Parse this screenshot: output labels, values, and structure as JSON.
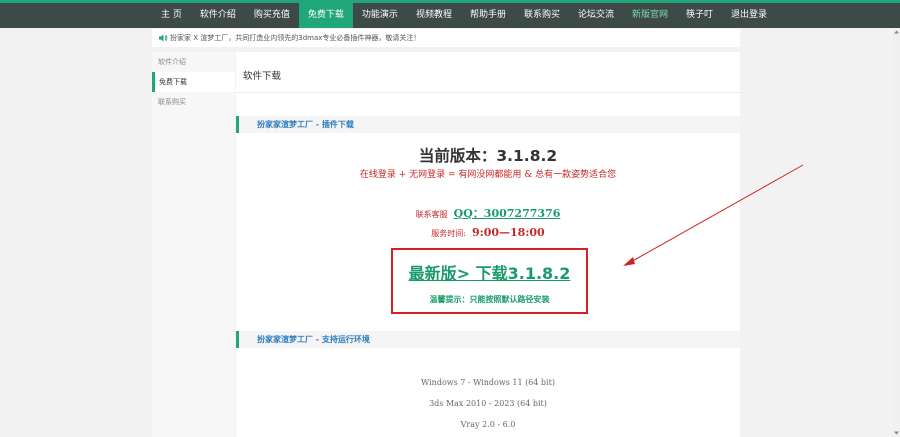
{
  "nav": {
    "items": [
      {
        "label": "主 页"
      },
      {
        "label": "软件介绍"
      },
      {
        "label": "购买充值"
      },
      {
        "label": "免费下载"
      },
      {
        "label": "功能演示"
      },
      {
        "label": "视频教程"
      },
      {
        "label": "帮助手册"
      },
      {
        "label": "联系购买"
      },
      {
        "label": "论坛交流"
      },
      {
        "label": "新版官网"
      },
      {
        "label": "筷子叮"
      },
      {
        "label": "退出登录"
      }
    ],
    "active_index": 3,
    "highlight_index": 9
  },
  "notice": {
    "icon": "speaker-icon",
    "text": "扮家家 X 渲梦工厂，共同打造业内领先的3dmax专业必备插件神器，敬请关注！"
  },
  "sidebar": {
    "items": [
      {
        "label": "软件介绍"
      },
      {
        "label": "免费下载"
      },
      {
        "label": "联系购买"
      }
    ],
    "active_index": 1
  },
  "main": {
    "title": "软件下载",
    "section1": "扮家家渲梦工厂 - 插件下载",
    "version": "当前版本：3.1.8.2",
    "tagline": "在线登录 + 无网登录 = 有网没网都能用 & 总有一款姿势适合您",
    "contact_label": "联系客服",
    "contact_qq": "QQ：3007277376",
    "hours_label": "服务时间:",
    "hours_value": "9:00—18:00",
    "download_link": "最新版> 下载3.1.8.2",
    "tip": "温馨提示：只能按照默认路径安装",
    "section2": "扮家家渲梦工厂 - 支持运行环境",
    "requirements": [
      "Windows 7 - Windows 11 (64 bit)",
      "3ds Max 2010 - 2023 (64 bit)",
      "Vray 2.0 - 6.0"
    ]
  },
  "colors": {
    "nav_bg": "#3d4a48",
    "accent": "#1fa67a",
    "red": "#d32020",
    "link_green": "#1a9b6a",
    "section_blue": "#2d7bbf"
  }
}
